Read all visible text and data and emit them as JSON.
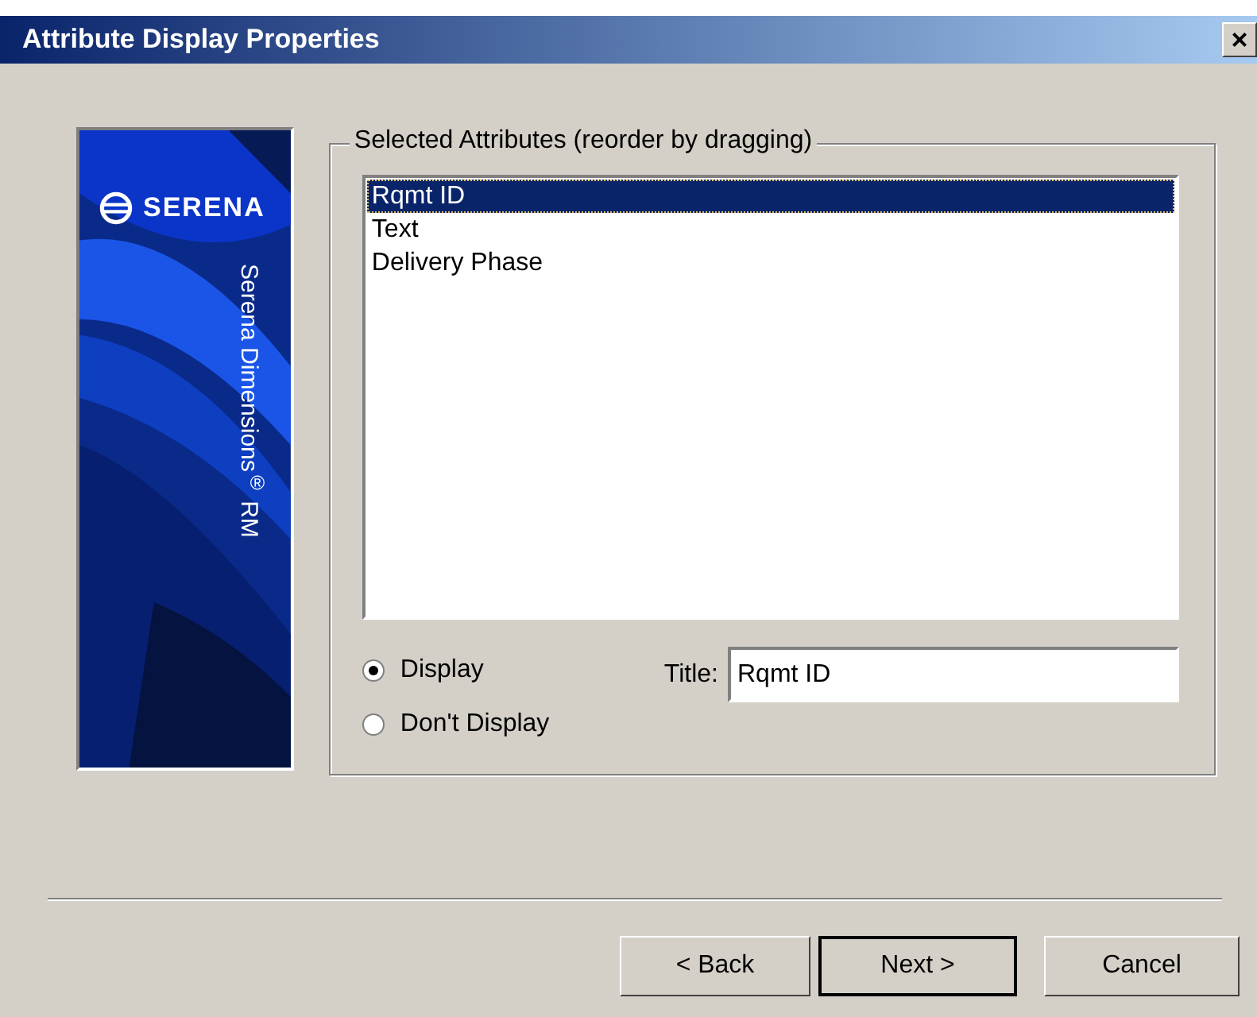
{
  "window": {
    "title": "Attribute Display Properties",
    "close": "×"
  },
  "banner": {
    "logo": "SERENA",
    "product": "Serena Dimensions$^{®}$ RM"
  },
  "group": {
    "label": "Selected Attributes (reorder by dragging)",
    "items": [
      {
        "label": "Rqmt ID",
        "selected": true
      },
      {
        "label": "Text",
        "selected": false
      },
      {
        "label": "Delivery Phase",
        "selected": false
      }
    ],
    "radios": [
      {
        "label": "Display",
        "selected": true
      },
      {
        "label": "Don't Display",
        "selected": false
      }
    ],
    "title_label": "Title:",
    "title_value": "Rqmt ID"
  },
  "buttons": [
    {
      "label": "< Back",
      "default": false
    },
    {
      "label": "Next >",
      "default": true
    },
    {
      "label": "Cancel",
      "default": false
    }
  ]
}
